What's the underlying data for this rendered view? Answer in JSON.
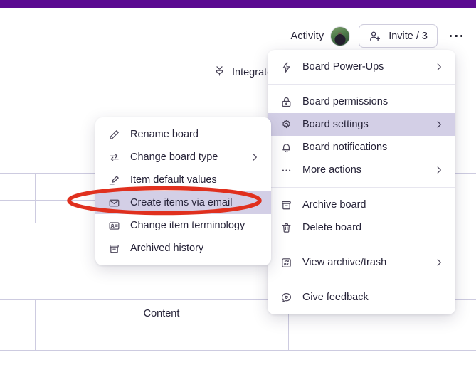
{
  "theme": {
    "brand_purple": "#5b0a91",
    "selected_bg": "#d3cfe6",
    "annotation_red": "#e0301e",
    "grid_line": "#cdcbe0",
    "text": "#262338"
  },
  "header": {
    "activity_label": "Activity",
    "avatar_name": "user-avatar",
    "invite_label": "Invite / 3",
    "more_label": "..."
  },
  "toolbar": {
    "integrate_label": "Integrate"
  },
  "board_grid": {
    "content_cell_label": "Content"
  },
  "menu_main": {
    "groups": [
      {
        "items": [
          {
            "label": "Board Power-Ups",
            "icon": "lightning-icon",
            "submenu": true,
            "selected": false
          }
        ]
      },
      {
        "items": [
          {
            "label": "Board permissions",
            "icon": "lock-icon",
            "submenu": false,
            "selected": false
          },
          {
            "label": "Board settings",
            "icon": "gear-icon",
            "submenu": true,
            "selected": true
          },
          {
            "label": "Board notifications",
            "icon": "bell-icon",
            "submenu": false,
            "selected": false
          },
          {
            "label": "More actions",
            "icon": "ellipsis-icon",
            "submenu": true,
            "selected": false
          }
        ]
      },
      {
        "items": [
          {
            "label": "Archive board",
            "icon": "archive-icon",
            "submenu": false,
            "selected": false
          },
          {
            "label": "Delete board",
            "icon": "trash-icon",
            "submenu": false,
            "selected": false
          }
        ]
      },
      {
        "items": [
          {
            "label": "View archive/trash",
            "icon": "archive-box-icon",
            "submenu": true,
            "selected": false
          }
        ]
      },
      {
        "items": [
          {
            "label": "Give feedback",
            "icon": "feedback-heart-icon",
            "submenu": false,
            "selected": false
          }
        ]
      }
    ]
  },
  "menu_sub": {
    "items": [
      {
        "label": "Rename board",
        "icon": "pencil-icon",
        "submenu": false,
        "selected": false
      },
      {
        "label": "Change board type",
        "icon": "swap-icon",
        "submenu": true,
        "selected": false
      },
      {
        "label": "Item default values",
        "icon": "highlighter-icon",
        "submenu": false,
        "selected": false
      },
      {
        "label": "Create items via email",
        "icon": "envelope-icon",
        "submenu": false,
        "selected": true
      },
      {
        "label": "Change item terminology",
        "icon": "id-card-icon",
        "submenu": false,
        "selected": false
      },
      {
        "label": "Archived history",
        "icon": "archive-icon",
        "submenu": false,
        "selected": false
      }
    ]
  },
  "annotation": {
    "name": "red-ellipse-highlight",
    "target": "Create items via email"
  }
}
